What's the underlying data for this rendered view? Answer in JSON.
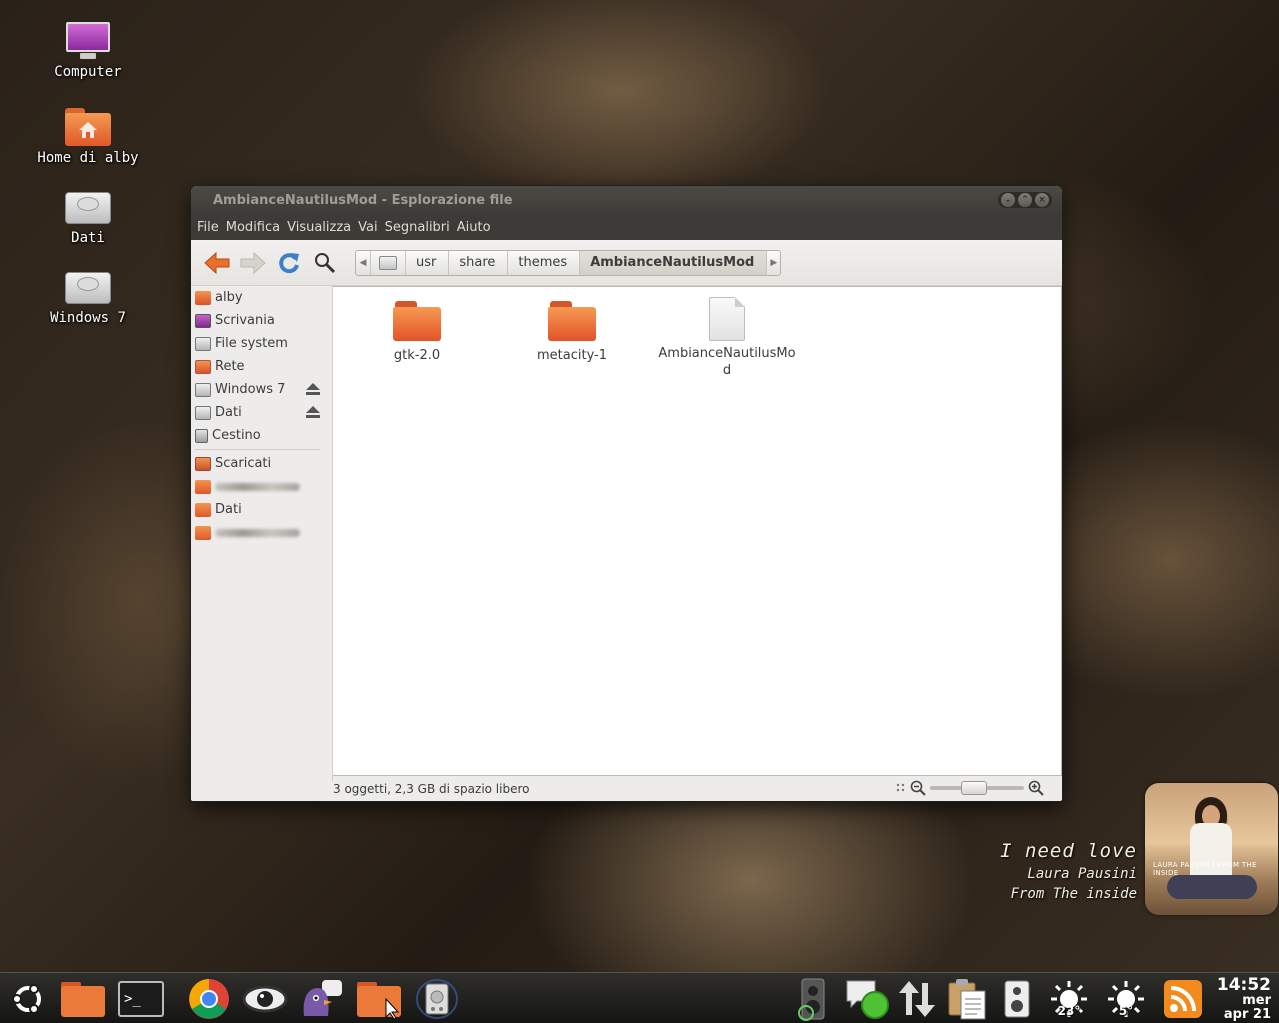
{
  "desktop": {
    "icons": [
      {
        "label": "Computer",
        "icon": "computer-icon"
      },
      {
        "label": "Home di alby",
        "icon": "home-folder-icon"
      },
      {
        "label": "Dati",
        "icon": "drive-icon"
      },
      {
        "label": "Windows 7",
        "icon": "drive-icon"
      }
    ]
  },
  "window": {
    "title": "AmbianceNautilusMod - Esplorazione file",
    "controls": [
      "minimize",
      "maximize",
      "close"
    ],
    "menu": [
      "File",
      "Modifica",
      "Visualizza",
      "Vai",
      "Segnalibri",
      "Aiuto"
    ],
    "toolbar": {
      "buttons": [
        "back-icon",
        "forward-icon",
        "reload-icon",
        "search-icon"
      ]
    },
    "path": [
      "usr",
      "share",
      "themes",
      "AmbianceNautilusMod"
    ],
    "sidebar": {
      "places": [
        {
          "label": "alby",
          "icon": "home-icon"
        },
        {
          "label": "Scrivania",
          "icon": "desktop-icon"
        },
        {
          "label": "File system",
          "icon": "filesystem-icon"
        },
        {
          "label": "Rete",
          "icon": "network-icon"
        },
        {
          "label": "Windows 7",
          "icon": "drive-icon",
          "eject": true
        },
        {
          "label": "Dati",
          "icon": "drive-icon",
          "eject": true
        },
        {
          "label": "Cestino",
          "icon": "trash-icon"
        }
      ],
      "bookmarks": [
        {
          "label": "Scaricati",
          "icon": "downloads-icon"
        },
        {
          "label": "",
          "icon": "folder-icon",
          "blurred": true
        },
        {
          "label": "Dati",
          "icon": "folder-icon"
        },
        {
          "label": "",
          "icon": "folder-icon",
          "blurred": true
        }
      ]
    },
    "files": [
      {
        "name": "gtk-2.0",
        "type": "folder"
      },
      {
        "name": "metacity-1",
        "type": "folder"
      },
      {
        "name": "AmbianceNautilusMod",
        "type": "file"
      }
    ],
    "status": "3 oggetti, 2,3 GB di spazio libero",
    "zoom_level": 0.45
  },
  "music": {
    "song": "I need love",
    "artist": "Laura Pausini",
    "album": "From The inside",
    "cover_caption": "LAURA PAUSINI | FROM THE INSIDE"
  },
  "taskbar": {
    "launchers": [
      "ubuntu-logo-icon",
      "folder-icon",
      "terminal-icon",
      "chrome-icon",
      "eye-of-gnome-icon",
      "pidgin-icon",
      "folder-icon",
      "disk-icon"
    ],
    "tray": [
      "volume-icon",
      "chat-status-icon",
      "network-transfer-icon",
      "clipboard-icon",
      "speaker-icon",
      "weather-icon",
      "weather-icon",
      "rss-icon"
    ],
    "weather_temps": [
      "23°",
      "5°"
    ],
    "clock": {
      "time": "14:52",
      "day": "mer",
      "date": "apr 21"
    }
  }
}
